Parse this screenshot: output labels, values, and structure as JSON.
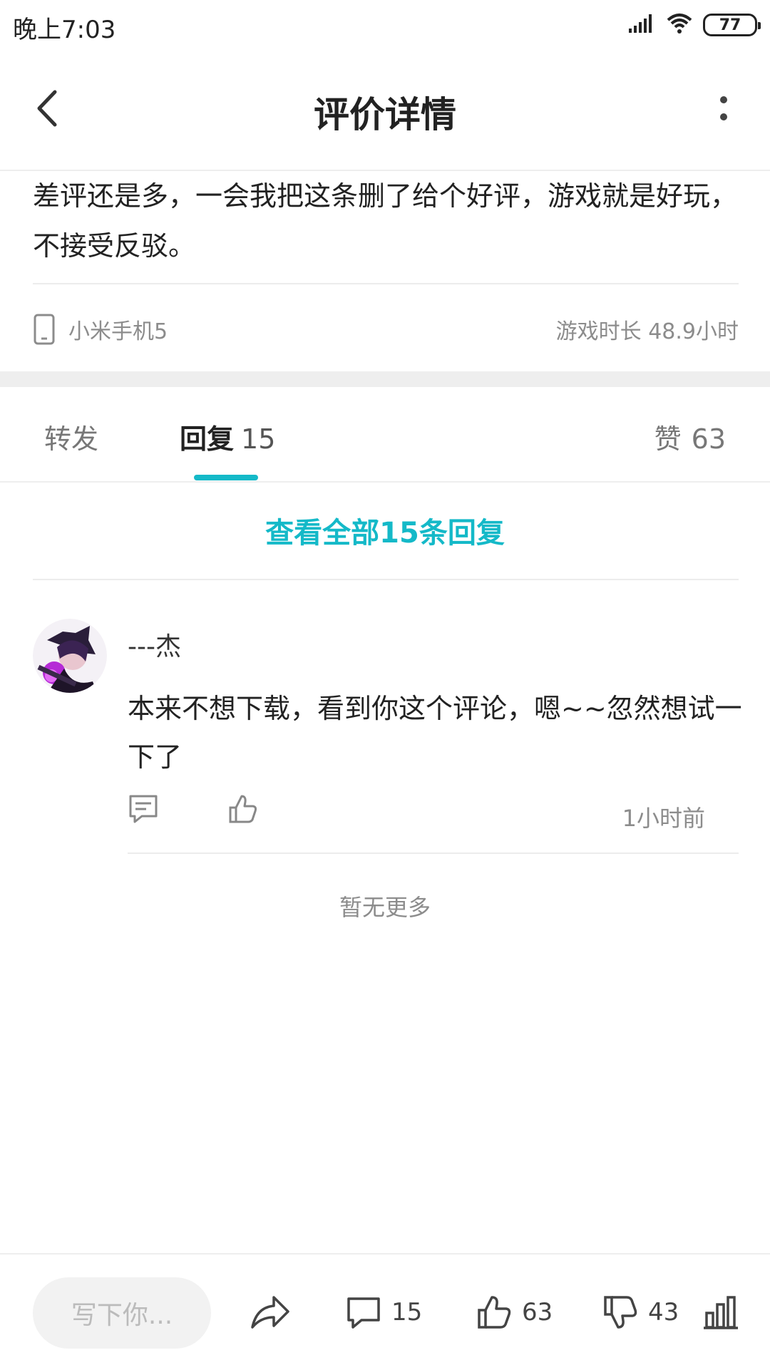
{
  "status_bar": {
    "time": "晚上7:03",
    "battery": "77"
  },
  "app_bar": {
    "title": "评价详情"
  },
  "review": {
    "text": "差评还是多，一会我把这条删了给个好评，游戏就是好玩，不接受反驳。",
    "device": "小米手机5",
    "play_time": "游戏时长 48.9小时"
  },
  "tabs": {
    "forward": "转发",
    "reply": "回复",
    "reply_count": "15",
    "like": "赞",
    "like_count": "63"
  },
  "view_all_label": "查看全部15条回复",
  "reply": {
    "username": "---杰",
    "content": "本来不想下载，看到你这个评论，嗯~~忽然想试一下了",
    "time": "1小时前"
  },
  "no_more_text": "暂无更多",
  "bottom_bar": {
    "input_placeholder": "写下你...",
    "comment_count": "15",
    "like_count": "63",
    "dislike_count": "43"
  },
  "colors": {
    "accent": "#14b9c8",
    "divider": "#eeeeee",
    "muted_text": "#8c8c8c"
  }
}
